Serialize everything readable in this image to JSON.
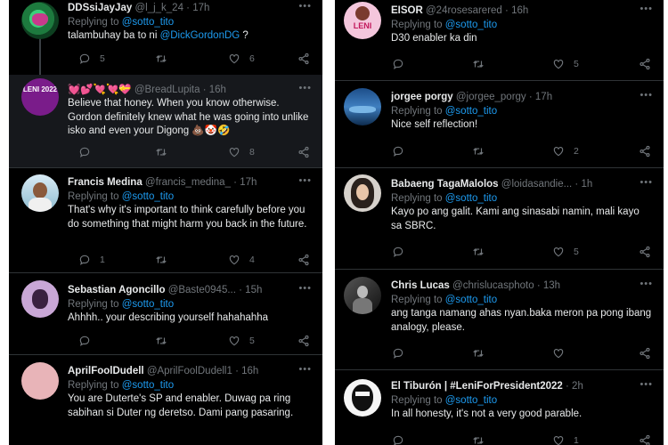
{
  "left": [
    {
      "name": "DDSsiJayJay",
      "handle": "@l_j_k_24",
      "time": "17h",
      "replying": "Replying to",
      "to": "@sotto_tito",
      "text_pre": "talambuhay ba to ni ",
      "text_mention": "@DickGordonDG",
      "text_post": " ?",
      "replies": "5",
      "retweets": "",
      "likes": "6"
    },
    {
      "name": "💓💕💘💘💝",
      "handle": "@BreadLupita",
      "time": "16h",
      "text": "Believe that honey. When you know otherwise. Gordon definitely knew what he was going into unlike isko and even your Digong 💩🤡🤣",
      "replies": "",
      "retweets": "",
      "likes": "8",
      "avatar_text": "LENI 2022"
    },
    {
      "name": "Francis Medina",
      "handle": "@francis_medina_",
      "time": "17h",
      "replying": "Replying to",
      "to": "@sotto_tito",
      "text": "That's why it's important to think carefully before you do something that might harm you back in the future.",
      "replies": "1",
      "retweets": "",
      "likes": "4"
    },
    {
      "name": "Sebastian Agoncillo",
      "handle": "@Baste0945...",
      "time": "15h",
      "replying": "Replying to",
      "to": "@sotto_tito",
      "text": "Ahhhh.. your describing yourself hahahahha",
      "replies": "",
      "retweets": "",
      "likes": "5"
    },
    {
      "name": "AprilFoolDudell",
      "handle": "@AprilFoolDudell1",
      "time": "16h",
      "replying": "Replying to",
      "to": "@sotto_tito",
      "text": "You are Duterte's SP and enabler. Duwag pa ring sabihan si Duter ng deretso. Dami pang pasaring.",
      "replies": "",
      "retweets": "",
      "likes": ""
    }
  ],
  "right": [
    {
      "name": "EISOR",
      "handle": "@24rosesarered",
      "time": "16h",
      "replying": "Replying to",
      "to": "@sotto_tito",
      "text": "D30 enabler ka din",
      "replies": "",
      "retweets": "",
      "likes": "5",
      "avatar_text": "LENI"
    },
    {
      "name": "jorgee porgy",
      "handle": "@jorgee_porgy",
      "time": "17h",
      "replying": "Replying to",
      "to": "@sotto_tito",
      "text": "Nice self reflection!",
      "replies": "",
      "retweets": "",
      "likes": "2"
    },
    {
      "name": "Babaeng TagaMalolos",
      "handle": "@loidasandie...",
      "time": "1h",
      "replying": "Replying to",
      "to": "@sotto_tito",
      "text": "Kayo po ang galit. Kami ang sinasabi namin, mali kayo sa SBRC.",
      "replies": "",
      "retweets": "",
      "likes": "5"
    },
    {
      "name": "Chris Lucas",
      "handle": "@chrislucasphoto",
      "time": "13h",
      "replying": "Replying to",
      "to": "@sotto_tito",
      "text": "ang tanga namang ahas nyan.baka meron pa pong ibang analogy, please.",
      "replies": "",
      "retweets": "",
      "likes": ""
    },
    {
      "name": "El Tiburón | #LeniForPresident2022",
      "handle": "",
      "time": "2h",
      "replying": "Replying to",
      "to": "@sotto_tito",
      "text": "In all honesty, it's not a very good parable.",
      "replies": "",
      "retweets": "",
      "likes": "1"
    }
  ],
  "colors": {
    "bg": "#000000",
    "text": "#e7e9ea",
    "muted": "#71767b",
    "link": "#1d9bf0"
  }
}
